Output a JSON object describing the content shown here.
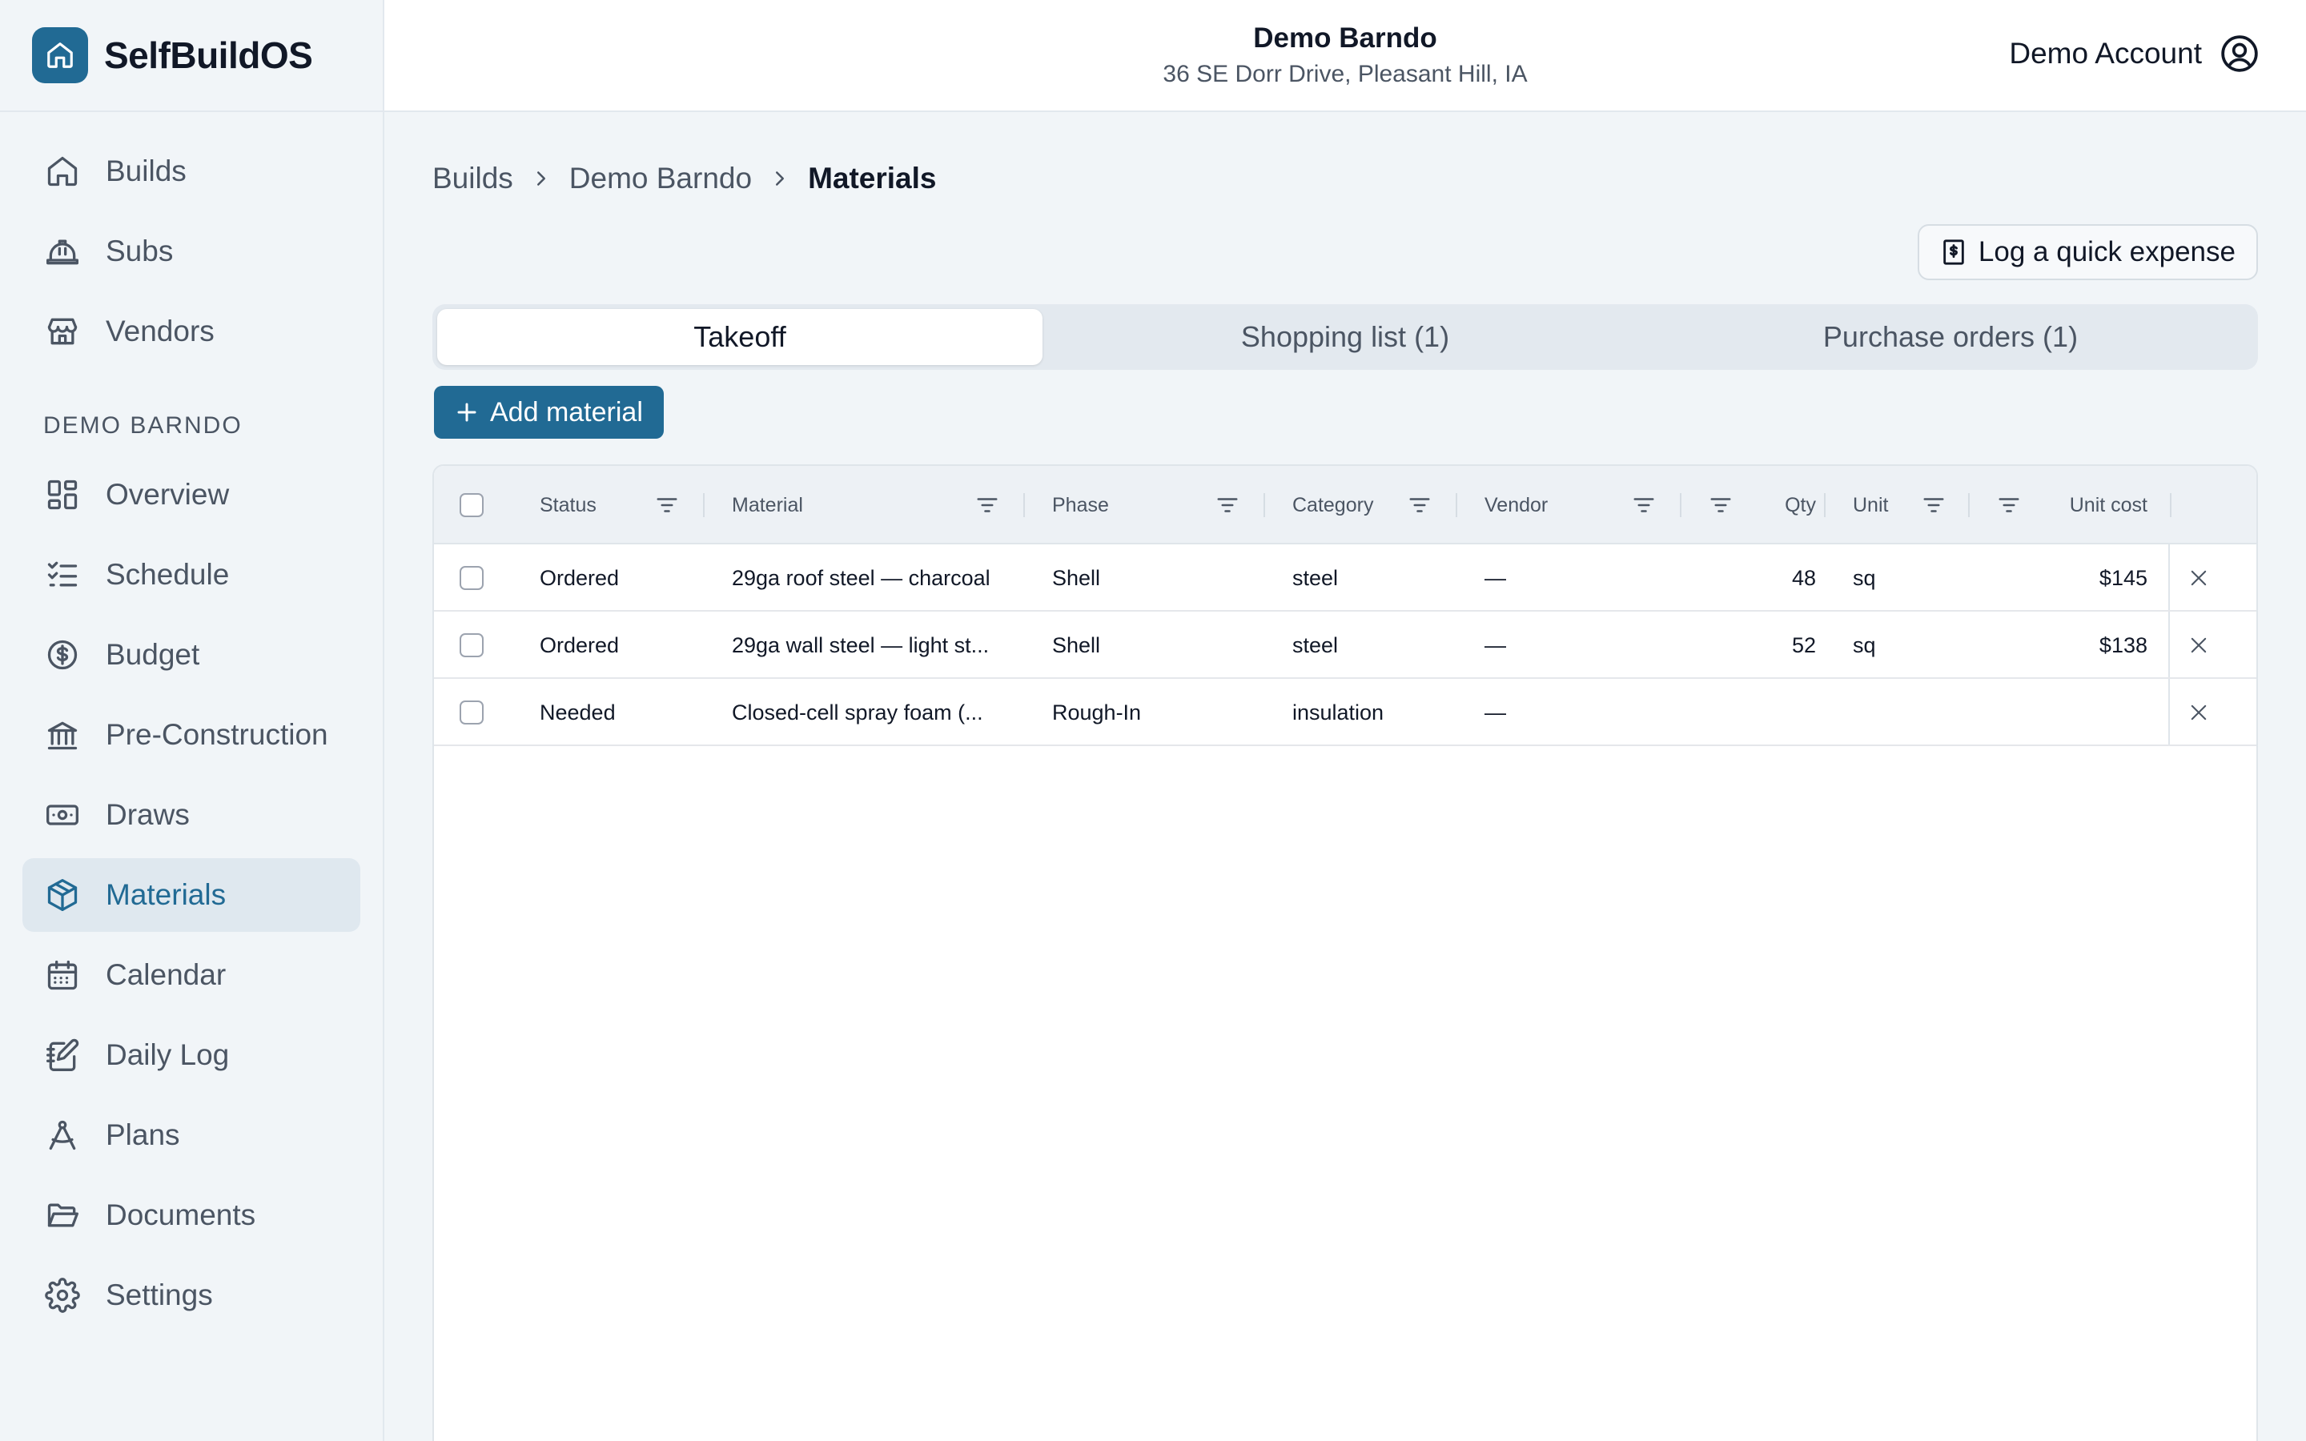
{
  "brand": {
    "name": "SelfBuildOS",
    "icon": "home-icon"
  },
  "header": {
    "project_name": "Demo Barndo",
    "project_address": "36 SE Dorr Drive, Pleasant Hill, IA",
    "account_label": "Demo Account"
  },
  "sidebar": {
    "top_items": [
      {
        "label": "Builds",
        "icon": "home-icon"
      },
      {
        "label": "Subs",
        "icon": "hard-hat-icon"
      },
      {
        "label": "Vendors",
        "icon": "store-icon"
      }
    ],
    "section_title": "DEMO BARNDO",
    "items": [
      {
        "label": "Overview",
        "icon": "grid-icon"
      },
      {
        "label": "Schedule",
        "icon": "checklist-icon"
      },
      {
        "label": "Budget",
        "icon": "dollar-circle-icon"
      },
      {
        "label": "Pre-Construction",
        "icon": "bank-icon"
      },
      {
        "label": "Draws",
        "icon": "banknote-icon"
      },
      {
        "label": "Materials",
        "icon": "package-icon",
        "active": true
      },
      {
        "label": "Calendar",
        "icon": "calendar-icon"
      },
      {
        "label": "Daily Log",
        "icon": "notebook-pen-icon"
      },
      {
        "label": "Plans",
        "icon": "compass-icon"
      },
      {
        "label": "Documents",
        "icon": "folder-icon"
      },
      {
        "label": "Settings",
        "icon": "gear-icon"
      }
    ]
  },
  "breadcrumb": {
    "items": [
      "Builds",
      "Demo Barndo"
    ],
    "current": "Materials"
  },
  "quick_expense_label": "Log a quick expense",
  "tabs": [
    {
      "label": "Takeoff",
      "active": true
    },
    {
      "label": "Shopping list (1)"
    },
    {
      "label": "Purchase orders (1)"
    }
  ],
  "add_material_label": "Add material",
  "table": {
    "columns": [
      "Status",
      "Material",
      "Phase",
      "Category",
      "Vendor",
      "Qty",
      "Unit",
      "Unit cost"
    ],
    "rows": [
      {
        "status": "Ordered",
        "material": "29ga roof steel — charcoal",
        "phase": "Shell",
        "category": "steel",
        "vendor": "—",
        "qty": "48",
        "unit": "sq",
        "unit_cost": "$145"
      },
      {
        "status": "Ordered",
        "material": "29ga wall steel — light st...",
        "phase": "Shell",
        "category": "steel",
        "vendor": "—",
        "qty": "52",
        "unit": "sq",
        "unit_cost": "$138"
      },
      {
        "status": "Needed",
        "material": "Closed-cell spray foam (...",
        "phase": "Rough-In",
        "category": "insulation",
        "vendor": "—",
        "qty": "",
        "unit": "",
        "unit_cost": ""
      }
    ]
  },
  "colors": {
    "accent": "#216a94",
    "background": "#f1f5f8",
    "active_nav_bg": "#dfe8ef"
  }
}
